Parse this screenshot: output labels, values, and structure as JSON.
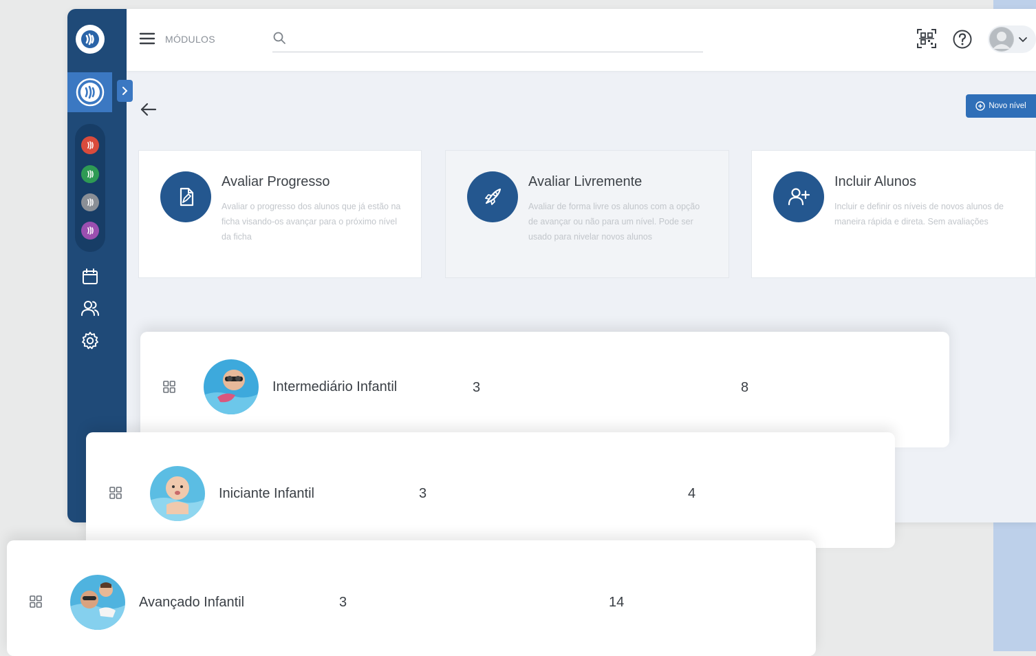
{
  "header": {
    "menu_label": "MÓDULOS",
    "search_placeholder": ""
  },
  "toolbar": {
    "new_level_label": "Novo nível"
  },
  "actions": [
    {
      "title": "Avaliar Progresso",
      "description": "Avaliar o progresso dos alunos que já estão na ficha visando-os avançar para o próximo nível da ficha",
      "icon": "document-edit-icon"
    },
    {
      "title": "Avaliar Livremente",
      "description": "Avaliar de forma livre os alunos com a opção de avançar ou não para um nível. Pode ser usado para nivelar novos alunos",
      "icon": "rocket-icon"
    },
    {
      "title": "Incluir Alunos",
      "description": "Incluir e definir os níveis de novos alunos de maneira rápida e direta. Sem avaliações",
      "icon": "add-user-icon"
    }
  ],
  "levels": [
    {
      "name": "Intermediário Infantil",
      "value_a": "3",
      "value_b": "8"
    },
    {
      "name": "Iniciante Infantil",
      "value_a": "3",
      "value_b": "4"
    },
    {
      "name": "Avançado Infantil",
      "value_a": "3",
      "value_b": "14"
    }
  ],
  "colors": {
    "primary": "#24578f",
    "sidebar": "#1f4a78",
    "accent": "#3b78c2",
    "module_dots": [
      "#d94b3c",
      "#2e9a54",
      "#8a8f96",
      "#9b4fb0"
    ]
  }
}
